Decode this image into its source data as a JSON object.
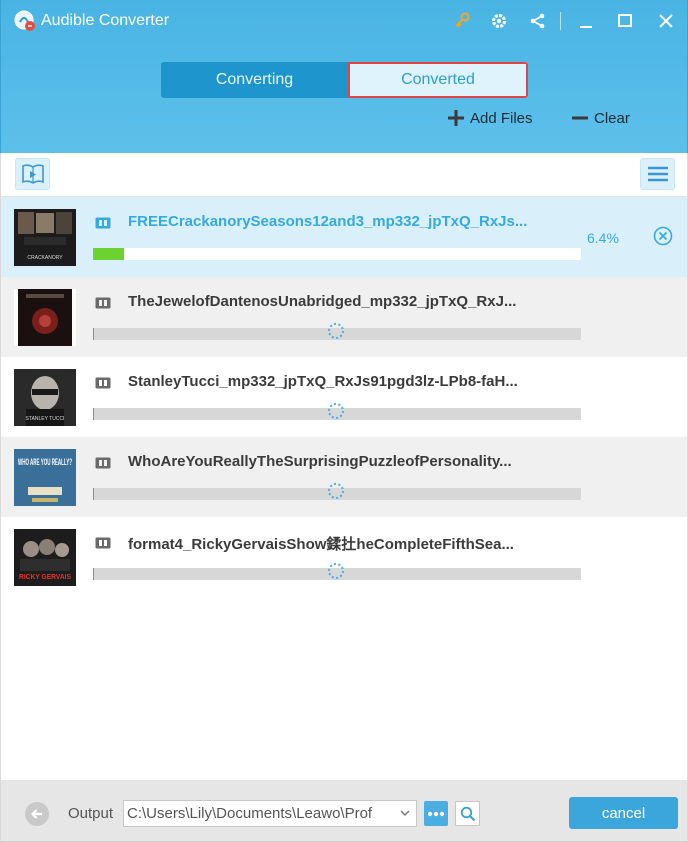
{
  "window": {
    "title": "Audible Converter",
    "accent": "#49b4e4"
  },
  "tabs": [
    {
      "label": "Converting",
      "active": false
    },
    {
      "label": "Converted",
      "active": true
    }
  ],
  "header_actions": {
    "add_files": "Add Files",
    "clear": "Clear"
  },
  "items": [
    {
      "title": "FREECrackanorySeasons12and3_mp332_jpTxQ_RxJs...",
      "progress_percent": 6.4,
      "progress_text": "6.4%",
      "state": "converting",
      "cover_text": "CRACKANORY"
    },
    {
      "title": "TheJewelofDantenosUnabridged_mp332_jpTxQ_RxJ...",
      "progress_percent": 0,
      "state": "waiting",
      "cover_text": ""
    },
    {
      "title": "StanleyTucci_mp332_jpTxQ_RxJs91pgd3lz-LPb8-faH...",
      "progress_percent": 0,
      "state": "waiting",
      "cover_text": "STANLEY TUCCI"
    },
    {
      "title": "WhoAreYouReallyTheSurprisingPuzzleofPersonality...",
      "progress_percent": 0,
      "state": "waiting",
      "cover_text": "WHO ARE YOU REALLY?"
    },
    {
      "title": "format4_RickyGervaisShow鍒扗heCompleteFifthSea...",
      "progress_percent": 0,
      "state": "waiting",
      "cover_text": "RICKY GERVAIS"
    }
  ],
  "footer": {
    "output_label": "Output",
    "output_path": "C:\\Users\\Lily\\Documents\\Leawo\\Prof",
    "cancel_label": "cancel"
  }
}
